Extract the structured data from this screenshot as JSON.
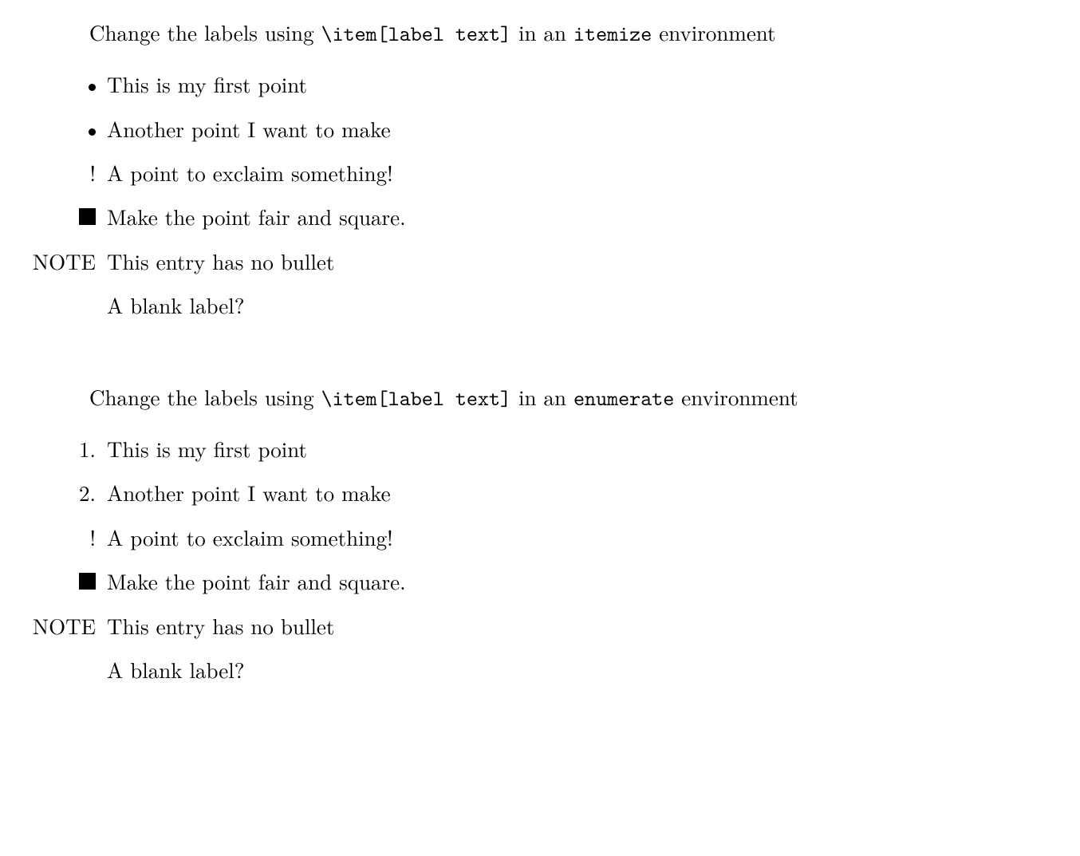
{
  "section1": {
    "intro_pre": "Change the labels using ",
    "intro_code": "\\item[label text]",
    "intro_mid": " in an ",
    "intro_env": "itemize",
    "intro_post": " environment",
    "items": [
      {
        "labelType": "dot",
        "labelText": "",
        "content": "This is my first point"
      },
      {
        "labelType": "dot",
        "labelText": "",
        "content": "Another point I want to make"
      },
      {
        "labelType": "excl",
        "labelText": "!",
        "content": "A point to exclaim something!"
      },
      {
        "labelType": "square",
        "labelText": "",
        "content": "Make the point fair and square."
      },
      {
        "labelType": "note",
        "labelText": "NOTE",
        "content": "This entry has no bullet"
      },
      {
        "labelType": "blank",
        "labelText": "",
        "content": "A blank label?"
      }
    ]
  },
  "section2": {
    "intro_pre": "Change the labels using ",
    "intro_code": "\\item[label text]",
    "intro_mid": " in an ",
    "intro_env": "enumerate",
    "intro_post": " environment",
    "items": [
      {
        "labelType": "num",
        "labelText": "1.",
        "content": "This is my first point"
      },
      {
        "labelType": "num",
        "labelText": "2.",
        "content": "Another point I want to make"
      },
      {
        "labelType": "excl",
        "labelText": "!",
        "content": "A point to exclaim something!"
      },
      {
        "labelType": "square",
        "labelText": "",
        "content": "Make the point fair and square."
      },
      {
        "labelType": "note",
        "labelText": "NOTE",
        "content": "This entry has no bullet"
      },
      {
        "labelType": "blank",
        "labelText": "",
        "content": "A blank label?"
      }
    ]
  }
}
